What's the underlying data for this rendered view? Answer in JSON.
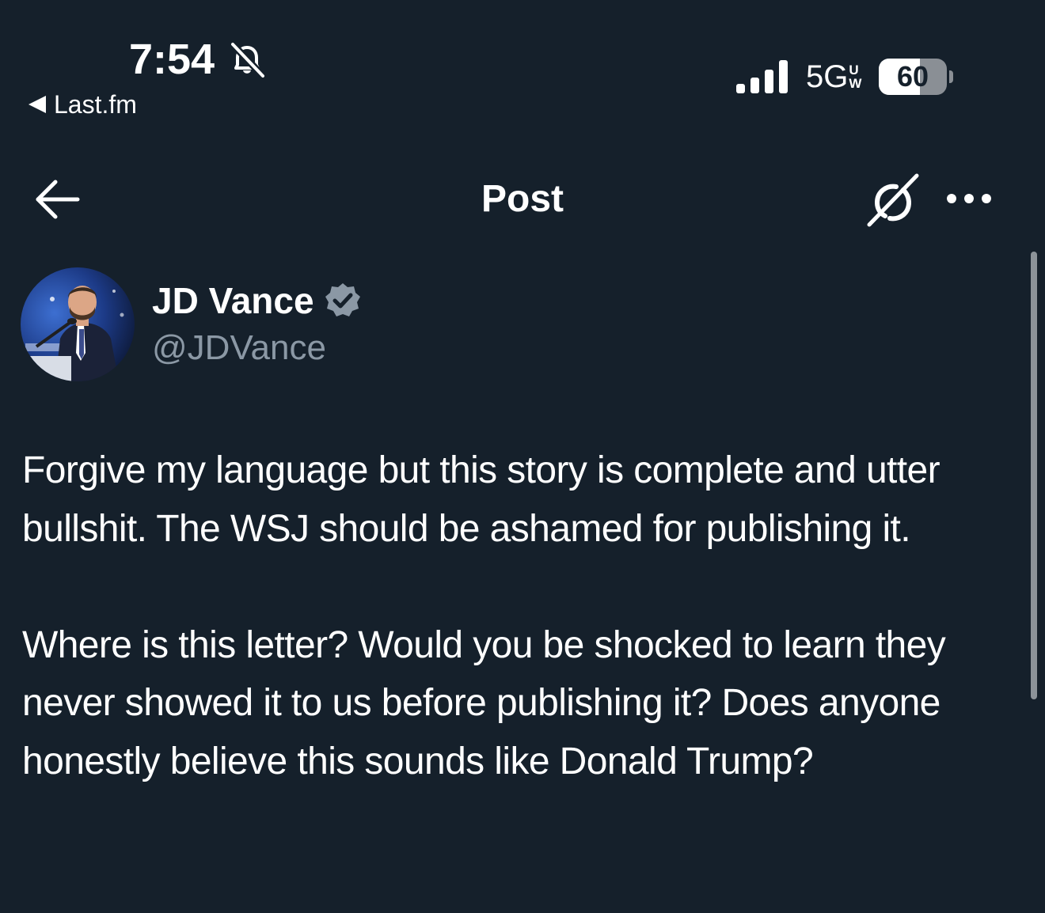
{
  "status_bar": {
    "time": "7:54",
    "return_app": "Last.fm",
    "network": "5G",
    "network_superscript_top": "U",
    "network_superscript_bottom": "W",
    "battery_level": "60",
    "battery_fraction": 0.6,
    "icons": [
      "bell-slash-icon",
      "cellular-signal-icon",
      "battery-icon"
    ]
  },
  "header": {
    "title": "Post",
    "icons": [
      "back-arrow-icon",
      "grok-icon",
      "more-icon"
    ]
  },
  "post": {
    "author": {
      "name": "JD Vance",
      "handle": "@JDVance",
      "verified": true
    },
    "paragraphs": [
      "Forgive my language but this story is complete and utter bullshit. The WSJ should be ashamed for publishing it.",
      "Where is this letter? Would you be shocked to learn they never showed it to us before publishing it? Does anyone honestly believe this sounds like Donald Trump?"
    ]
  },
  "colors": {
    "background": "#15202b",
    "text_primary": "#ffffff",
    "text_secondary": "#8b98a5",
    "verified_badge": "#8b98a5"
  }
}
